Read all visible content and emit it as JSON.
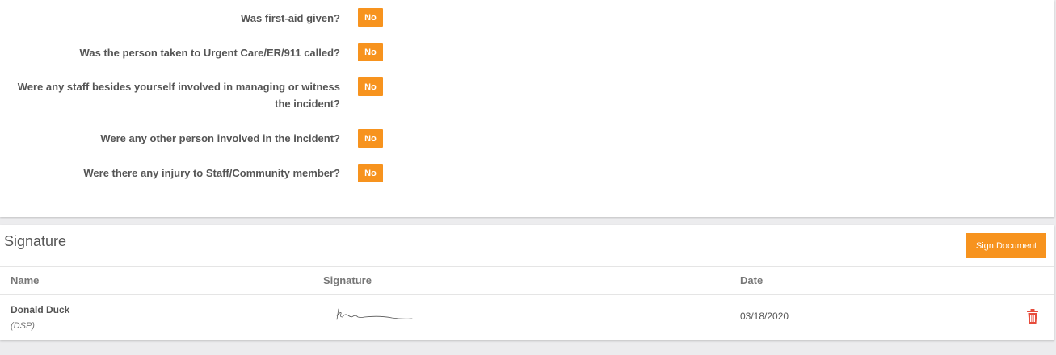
{
  "questions": [
    {
      "label": "Was first-aid given?",
      "answer": "No"
    },
    {
      "label": "Was the person taken to Urgent Care/ER/911 called?",
      "answer": "No"
    },
    {
      "label": "Were any staff besides yourself involved in managing or witness the incident?",
      "answer": "No"
    },
    {
      "label": "Were any other person involved in the incident?",
      "answer": "No"
    },
    {
      "label": "Were there any injury to Staff/Community member?",
      "answer": "No"
    }
  ],
  "signature": {
    "title": "Signature",
    "sign_button": "Sign Document",
    "columns": {
      "name": "Name",
      "signature": "Signature",
      "date": "Date"
    },
    "rows": [
      {
        "name": "Donald Duck",
        "role": "(DSP)",
        "date": "03/18/2020"
      }
    ]
  },
  "colors": {
    "accent": "#f7931e",
    "delete": "#e74c3c"
  },
  "icons": {
    "delete": "trash-icon"
  }
}
